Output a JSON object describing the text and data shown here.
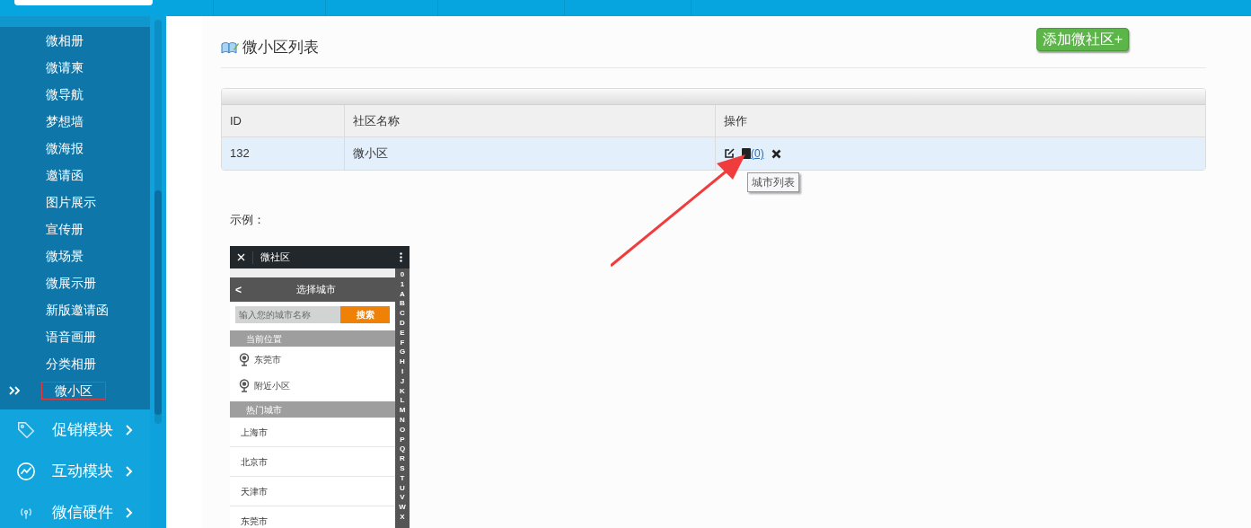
{
  "sidebar": {
    "submenu": [
      {
        "label": "微相册",
        "selected": false
      },
      {
        "label": "微请柬",
        "selected": false
      },
      {
        "label": "微导航",
        "selected": false
      },
      {
        "label": "梦想墙",
        "selected": false
      },
      {
        "label": "微海报",
        "selected": false
      },
      {
        "label": "邀请函",
        "selected": false
      },
      {
        "label": "图片展示",
        "selected": false
      },
      {
        "label": "宣传册",
        "selected": false
      },
      {
        "label": "微场景",
        "selected": false
      },
      {
        "label": "微展示册",
        "selected": false
      },
      {
        "label": "新版邀请函",
        "selected": false
      },
      {
        "label": "语音画册",
        "selected": false
      },
      {
        "label": "分类相册",
        "selected": false
      },
      {
        "label": "微小区",
        "selected": true
      }
    ],
    "modules": [
      {
        "label": "促销模块"
      },
      {
        "label": "互动模块"
      },
      {
        "label": "微信硬件"
      }
    ]
  },
  "page": {
    "title": "微小区列表",
    "add_button": "添加微社区+",
    "table": {
      "columns": [
        "ID",
        "社区名称",
        "操作"
      ],
      "rows": [
        {
          "id": "132",
          "name": "微小区",
          "link": "(0)"
        }
      ]
    },
    "tooltip": "城市列表",
    "example_label": "示例：",
    "phone": {
      "app_title": "微社区",
      "header": "选择城市",
      "back": "<",
      "search_placeholder": "输入您的城市名称",
      "search_button": "搜索",
      "sections": [
        {
          "label": "当前位置",
          "kind": "location",
          "items": [
            "东莞市",
            "附近小区"
          ]
        },
        {
          "label": "热门城市",
          "kind": "list",
          "items": [
            "上海市",
            "北京市",
            "天津市",
            "东莞市"
          ]
        }
      ],
      "index": [
        "0",
        "1",
        "A",
        "B",
        "C",
        "D",
        "E",
        "F",
        "G",
        "H",
        "I",
        "J",
        "K",
        "L",
        "M",
        "N",
        "O",
        "P",
        "Q",
        "R",
        "S",
        "T",
        "U",
        "V",
        "W",
        "X"
      ]
    }
  }
}
